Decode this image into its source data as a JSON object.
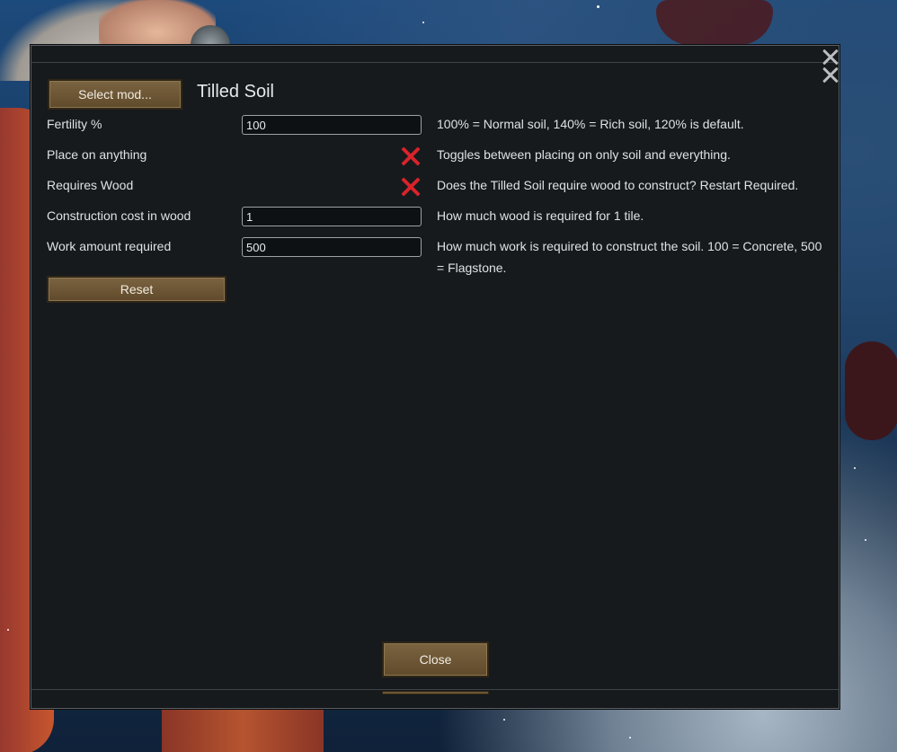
{
  "dialog": {
    "mod_title": "Tilled Soil",
    "select_mod_label": "Select mod...",
    "reset_label": "Reset",
    "close_label": "Close"
  },
  "settings": [
    {
      "label": "Fertility %",
      "type": "text",
      "value": "100",
      "description": "100% = Normal soil, 140% = Rich soil, 120% is default."
    },
    {
      "label": "Place on anything",
      "type": "checkbox",
      "checked": false,
      "icon": "x-mark-icon",
      "description": "Toggles between placing on only soil and everything."
    },
    {
      "label": "Requires Wood",
      "type": "checkbox",
      "checked": false,
      "icon": "x-mark-icon",
      "description": "Does the Tilled Soil require wood to construct? Restart Required."
    },
    {
      "label": "Construction cost in wood",
      "type": "text",
      "value": "1",
      "description": "How much wood is required for 1 tile."
    },
    {
      "label": "Work amount required",
      "type": "text",
      "value": "500",
      "description": "How much work is required to construct the soil. 100 = Concrete, 500 = Flagstone."
    }
  ],
  "colors": {
    "dialog_bg": "#161a1d",
    "button_brown": "#6e5736",
    "unchecked_x_red": "#d8232a",
    "text": "#dfe2e4"
  }
}
